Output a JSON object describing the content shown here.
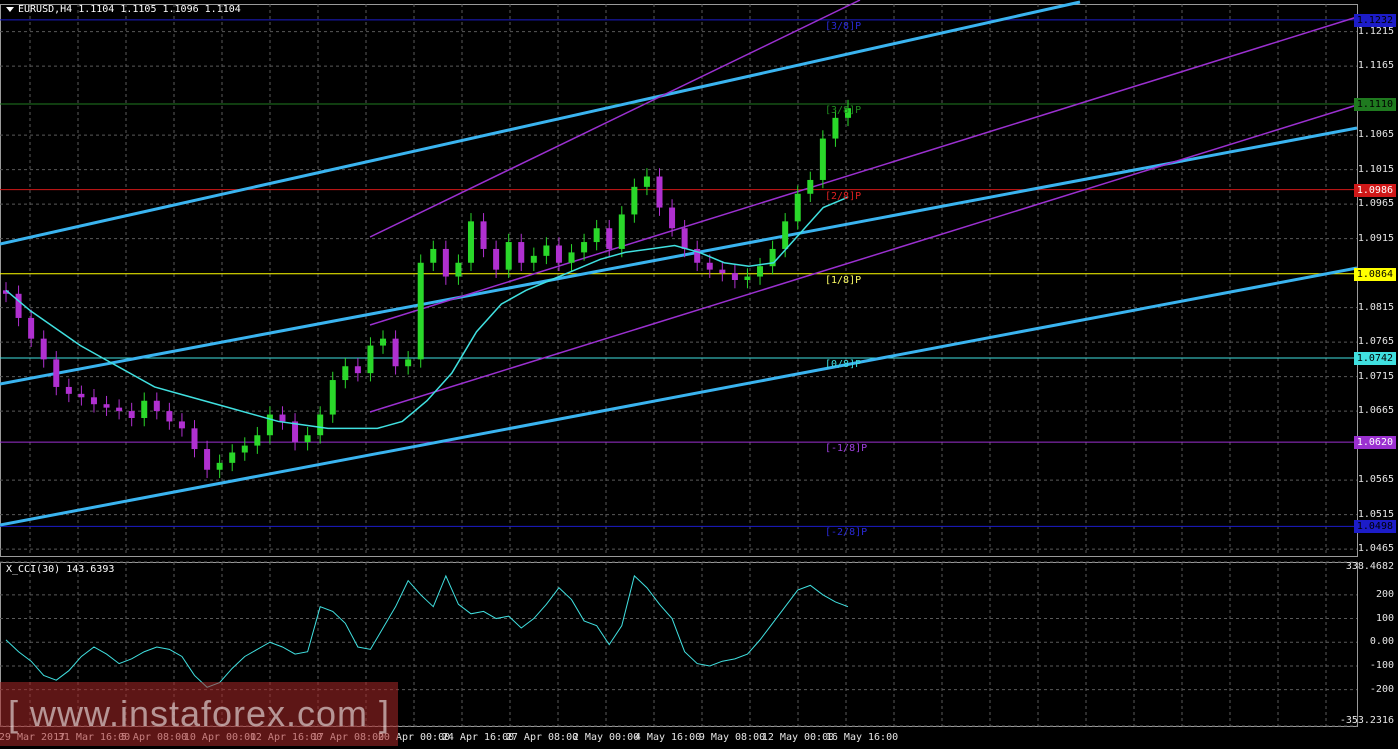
{
  "header": {
    "symbol_line": "EURUSD,H4  1.1104 1.1105 1.1096 1.1104",
    "cci_line": "X_CCI(30) 143.6393"
  },
  "price_axis": {
    "ticks": [
      "1.1215",
      "1.1165",
      "1.1065",
      "1.1015",
      "1.0965",
      "1.0915",
      "1.0815",
      "1.0765",
      "1.0715",
      "1.0665",
      "1.0565",
      "1.0515",
      "1.0465"
    ],
    "tick_values": [
      1.1215,
      1.1165,
      1.1065,
      1.1015,
      1.0965,
      1.0915,
      1.0815,
      1.0765,
      1.0715,
      1.0665,
      1.0565,
      1.0515,
      1.0465
    ],
    "range": [
      1.0455,
      1.1255
    ]
  },
  "cci_axis": {
    "ticks": [
      "338.4682",
      "200",
      "100",
      "0.00",
      "-100",
      "-200",
      "-353.2316"
    ],
    "tick_values": [
      338.4682,
      200,
      100,
      0,
      -100,
      -200,
      -353.2316
    ],
    "range": [
      -353.2316,
      338.4682
    ]
  },
  "price_tags": [
    {
      "label": "1.1232",
      "value": 1.1232,
      "bg": "#1c1cc8",
      "fg": "#000000"
    },
    {
      "label": "1.1110",
      "value": 1.111,
      "bg": "#1f7a1f",
      "fg": "#000000"
    },
    {
      "label": "1.0986",
      "value": 1.0986,
      "bg": "#d01818",
      "fg": "#ffffff"
    },
    {
      "label": "1.0864",
      "value": 1.0864,
      "bg": "#ffff00",
      "fg": "#000000"
    },
    {
      "label": "1.0742",
      "value": 1.0742,
      "bg": "#40e0e0",
      "fg": "#000000"
    },
    {
      "label": "1.0620",
      "value": 1.062,
      "bg": "#9b30d0",
      "fg": "#ffffff"
    },
    {
      "label": "1.0498",
      "value": 1.0498,
      "bg": "#1c1cc8",
      "fg": "#000000"
    }
  ],
  "murrey_labels": [
    {
      "label": "[3/8]P",
      "value": 1.1232,
      "color": "#2a2ad8"
    },
    {
      "label": "[3/8]P",
      "value": 1.111,
      "color": "#1f8a1f"
    },
    {
      "label": "[2/8]P",
      "value": 1.0986,
      "color": "#e02020"
    },
    {
      "label": "[1/8]P",
      "value": 1.0864,
      "color": "#ffff66"
    },
    {
      "label": "[0/8]P",
      "value": 1.0742,
      "color": "#40e0e0"
    },
    {
      "label": "[-1/8]P",
      "value": 1.062,
      "color": "#a040e0"
    },
    {
      "label": "[-2/8]P",
      "value": 1.0498,
      "color": "#2a2ad8"
    }
  ],
  "time_axis": [
    "29 Mar 2017",
    "31 Mar 16:00",
    "5 Apr 08:00",
    "10 Apr 00:00",
    "12 Apr 16:00",
    "17 Apr 08:00",
    "20 Apr 00:00",
    "24 Apr 16:00",
    "27 Apr 08:00",
    "2 May 00:00",
    "4 May 16:00",
    "9 May 08:00",
    "12 May 00:00",
    "16 May 16:00"
  ],
  "watermark": "[ www.instaforex.com ]",
  "colors": {
    "bull": "#2ad82a",
    "bear": "#b030d0",
    "ma": "#40e0e0",
    "cci": "#40e0e0",
    "channel_blue": "#3ab4f0",
    "channel_purple": "#9b30d0",
    "grid": "#5a5a5a"
  },
  "chart_data": {
    "type": "candlestick",
    "symbol": "EURUSD",
    "timeframe": "H4",
    "close_path": [
      1.0835,
      1.08,
      1.077,
      1.074,
      1.07,
      1.069,
      1.0685,
      1.0675,
      1.067,
      1.0665,
      1.0655,
      1.068,
      1.0665,
      1.065,
      1.064,
      1.061,
      1.058,
      1.059,
      1.0605,
      1.0615,
      1.063,
      1.066,
      1.065,
      1.062,
      1.063,
      1.066,
      1.071,
      1.073,
      1.072,
      1.076,
      1.077,
      1.073,
      1.074,
      1.088,
      1.09,
      1.086,
      1.088,
      1.094,
      1.09,
      1.087,
      1.091,
      1.088,
      1.089,
      1.0905,
      1.088,
      1.0895,
      1.091,
      1.093,
      1.09,
      1.095,
      1.099,
      1.1005,
      1.096,
      1.093,
      1.09,
      1.088,
      1.087,
      1.0865,
      1.0855,
      1.086,
      1.0875,
      1.09,
      1.094,
      1.098,
      1.1,
      1.106,
      1.109,
      1.1104
    ],
    "cci_path": [
      10,
      -40,
      -80,
      -140,
      -160,
      -120,
      -60,
      -20,
      -50,
      -90,
      -70,
      -40,
      -20,
      -30,
      -60,
      -140,
      -190,
      -170,
      -110,
      -60,
      -30,
      0,
      -20,
      -50,
      -40,
      150,
      130,
      80,
      -20,
      -30,
      60,
      150,
      260,
      200,
      150,
      280,
      160,
      120,
      130,
      100,
      110,
      60,
      100,
      160,
      230,
      180,
      90,
      70,
      -10,
      70,
      280,
      230,
      160,
      100,
      -40,
      -90,
      -100,
      -80,
      -70,
      -50,
      10,
      80,
      150,
      220,
      240,
      200,
      170,
      150
    ],
    "ma_path": [
      1.084,
      1.081,
      1.0785,
      1.076,
      1.074,
      1.072,
      1.07,
      1.069,
      1.068,
      1.067,
      1.066,
      1.065,
      1.0645,
      1.064,
      1.064,
      1.064,
      1.065,
      1.068,
      1.072,
      1.078,
      1.082,
      1.084,
      1.0855,
      1.087,
      1.0885,
      1.0895,
      1.09,
      1.0905,
      1.0895,
      1.088,
      1.0875,
      1.088,
      1.092,
      1.096,
      1.0975
    ]
  }
}
